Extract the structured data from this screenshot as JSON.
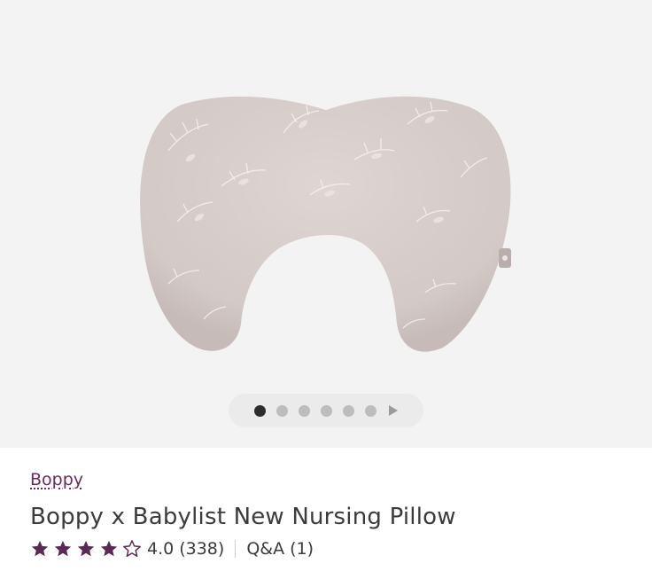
{
  "product": {
    "brand": "Boppy",
    "title": "Boppy x Babylist New Nursing Pillow",
    "rating": 4.0,
    "rating_text": "4.0",
    "review_count_text": "(338)",
    "qa_text": "Q&A (1)"
  },
  "gallery": {
    "image_count": 6,
    "active_index": 0
  },
  "colors": {
    "brand_link": "#6b2a5c",
    "star_fill": "#5a2a55",
    "pillow": "#d9d0cd",
    "gallery_bg": "#f3f3f3"
  }
}
